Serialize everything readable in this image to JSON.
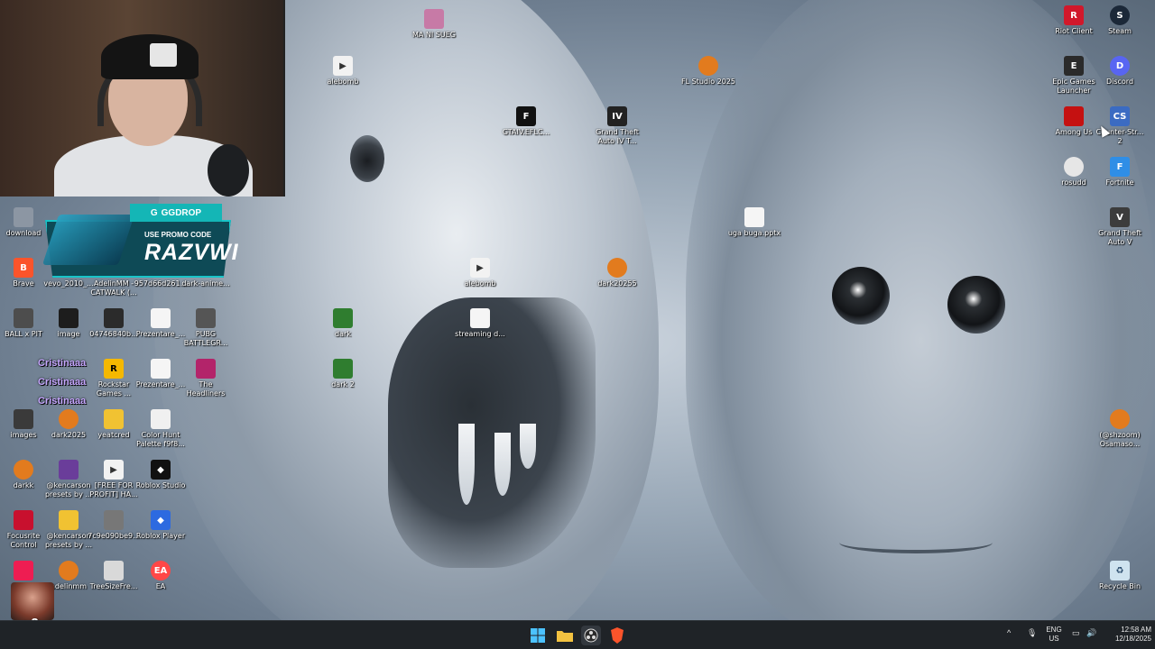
{
  "promo": {
    "brand": "GGDROP",
    "line1": "USE PROMO CODE",
    "code": "RAZVWI"
  },
  "chat": [
    "Cristinaaa",
    "Cristinaaa",
    "Cristinaaa"
  ],
  "overlay_multiplier": "x2",
  "icons": {
    "ma_ni_sueg": "MA NI SUEG",
    "alebomb_top": "alebomb",
    "gtaiv_eflc": "GTAIV.EFLC...",
    "gta4": "Grand Theft Auto IV T...",
    "fl_studio": "FL Studio 2025",
    "uga_buga": "uga buga.pptx",
    "alebomb_mid": "alebomb",
    "dark20255": "dark20255",
    "dark": "dark",
    "dark2": "dark 2",
    "streaming": "streaming d...",
    "riot": "Riot Client",
    "steam": "Steam",
    "epic": "Epic Games Launcher",
    "discord": "Discord",
    "among_us": "Among Us",
    "counter_strike": "Counter-Str... 2",
    "rosudd": "rosudd",
    "fortnite": "Fortnite",
    "gta5": "Grand Theft Auto V",
    "shzoom": "(@shzoom) Osamaso...",
    "recycle": "Recycle Bin",
    "download": "download",
    "brave": "Brave",
    "vevo": "vevo_2010_...",
    "adelinmm_catwalk": "AdelinMM - CATWALK (...",
    "hex957": "957d66d261...",
    "dark_anime": "dark-anime...",
    "ball_x_pit": "BALL x PIT",
    "image": "image",
    "hex04746": "04746840b...",
    "prezentare1": "Prezentare_...",
    "pubg": "PUBG BATTLEGR...",
    "rockstar": "Rockstar Games ...",
    "prezentare2": "Prezentare_...",
    "headliners": "The Headliners",
    "images": "images",
    "dark2025": "dark2025",
    "yeatcred": "yeatcred",
    "color_hunt": "Color Hunt Palette f9f8...",
    "darkk": "darkk",
    "kencarson1": "@kencarson presets by ...",
    "free_for_profit": "[FREE FOR PROFIT] HA...",
    "roblox_studio": "Roblox Studio",
    "focusrite": "Focusrite Control",
    "kencarson2": "@kencarson presets by ...",
    "hex7c9e": "7c9e090be9...",
    "roblox_player": "Roblox Player",
    "tiktok": "TikTok",
    "adelinmm": "adelinmm",
    "treesize": "TreeSizeFre...",
    "ea": "EA"
  },
  "taskbar": {
    "lang_top": "ENG",
    "lang_bottom": "US",
    "time": "12:58 AM",
    "date": "12/18/2025"
  },
  "colors": {
    "taskbar": "#1f2327",
    "accent": "#14b6b6",
    "chat": "#c6a7ff"
  }
}
